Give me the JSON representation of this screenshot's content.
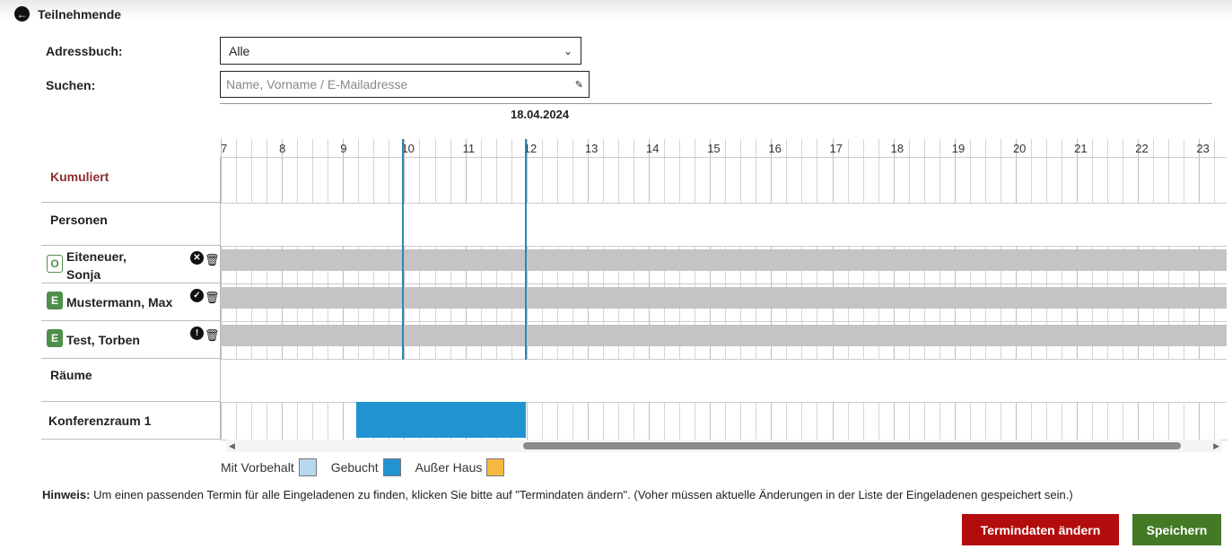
{
  "header": {
    "title": "Teilnehmende"
  },
  "form": {
    "addressbook_label": "Adressbuch:",
    "addressbook_value": "Alle",
    "search_label": "Suchen:",
    "search_placeholder": "Name, Vorname / E-Mailadresse"
  },
  "schedule": {
    "date": "18.04.2024",
    "hours": [
      "7",
      "8",
      "9",
      "10",
      "11",
      "12",
      "13",
      "14",
      "15",
      "16",
      "17",
      "18",
      "19",
      "20",
      "21",
      "22",
      "23"
    ],
    "rows": {
      "cumulative": "Kumuliert",
      "persons": "Personen",
      "rooms": "Räume"
    },
    "participants": [
      {
        "badge": "O",
        "name": "Eiteneuer,",
        "name2": "Sonja",
        "status": "declined"
      },
      {
        "badge": "E",
        "name": "Mustermann, Max",
        "name2": "",
        "status": "accepted"
      },
      {
        "badge": "E",
        "name": "Test, Torben",
        "name2": "",
        "status": "pending"
      }
    ],
    "room": {
      "name": "Konferenzraum 1"
    }
  },
  "legend": {
    "tentative": "Mit Vorbehalt",
    "booked": "Gebucht",
    "out_of_office": "Außer Haus",
    "colors": {
      "tentative": "#b7d9ec",
      "booked": "#2293d1",
      "out_of_office": "#f4b942"
    }
  },
  "hint": {
    "label": "Hinweis:",
    "text": "Um einen passenden Termin für alle Eingeladenen zu finden, klicken Sie bitte auf \"Termindaten ändern\". (Voher müssen aktuelle Änderungen in der Liste der Eingeladenen gespeichert sein.)"
  },
  "buttons": {
    "change": "Termindaten ändern",
    "save": "Speichern"
  }
}
